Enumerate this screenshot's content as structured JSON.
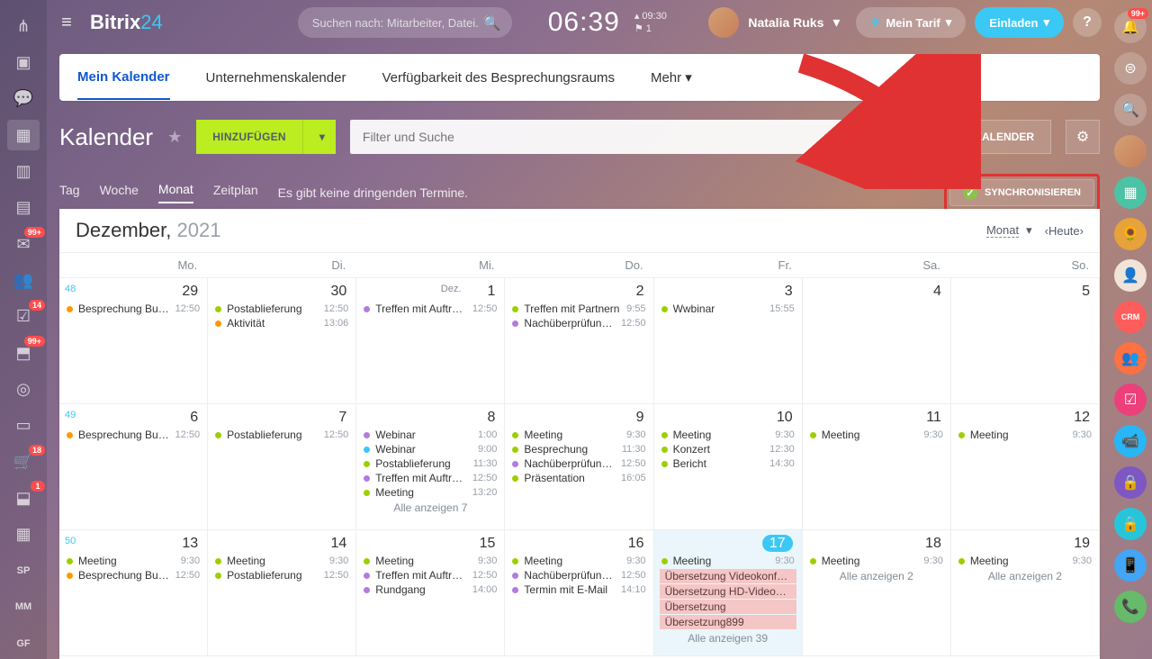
{
  "topbar": {
    "logo_prefix": "Bitrix",
    "logo_suffix": "24",
    "search_placeholder": "Suchen nach: Mitarbeiter, Datei...",
    "clock": "06:39",
    "clock_time": "09:30",
    "clock_flag": "1",
    "username": "Natalia Ruks",
    "tarif": "Mein Tarif",
    "invite": "Einladen"
  },
  "tabs": {
    "items": [
      "Mein Kalender",
      "Unternehmenskalender",
      "Verfügbarkeit des Besprechungsraums",
      "Mehr"
    ]
  },
  "header": {
    "title": "Kalender",
    "add": "HINZUFÜGEN",
    "filter_placeholder": "Filter und Suche",
    "kalender": "KALENDER"
  },
  "viewbar": {
    "tag": "Tag",
    "woche": "Woche",
    "monat": "Monat",
    "zeitplan": "Zeitplan",
    "msg": "Es gibt keine dringenden Termine.",
    "sync": "SYNCHRONISIEREN"
  },
  "calhead": {
    "month": "Dezember, ",
    "year": "2021",
    "monat": "Monat",
    "heute": "Heute"
  },
  "weekdays": [
    "Mo.",
    "Di.",
    "Mi.",
    "Do.",
    "Fr.",
    "Sa.",
    "So."
  ],
  "left_rail": [
    {
      "icon": "⋔"
    },
    {
      "icon": "▣"
    },
    {
      "icon": "💬"
    },
    {
      "icon": "▦",
      "active": true
    },
    {
      "icon": "▥"
    },
    {
      "icon": "▤"
    },
    {
      "icon": "✉",
      "badge": "99+"
    },
    {
      "icon": "👥"
    },
    {
      "icon": "☑",
      "badge": "14"
    },
    {
      "icon": "⬒",
      "badge": "99+"
    },
    {
      "icon": "◎"
    },
    {
      "icon": "▭"
    },
    {
      "icon": "🛒",
      "badge": "18"
    },
    {
      "icon": "⬓",
      "badge": "1"
    },
    {
      "icon": "▦"
    },
    {
      "txt": "SP"
    },
    {
      "txt": "MM"
    },
    {
      "txt": "GF"
    }
  ],
  "right_rail": [
    {
      "bg": "rgba(255,255,255,.2)",
      "icon": "🔔",
      "badge": "99+"
    },
    {
      "bg": "rgba(255,255,255,.2)",
      "icon": "⊜"
    },
    {
      "bg": "rgba(255,255,255,.2)",
      "icon": "🔍"
    },
    {
      "bg": "linear-gradient(135deg,#d4a074,#c67e5a)",
      "icon": ""
    },
    {
      "bg": "#4cc3a5",
      "icon": "▦"
    },
    {
      "bg": "#e8a23a",
      "icon": "🌻"
    },
    {
      "bg": "#f0e4d8",
      "icon": "👤"
    },
    {
      "bg": "#ff5c5c",
      "icon": "CRM",
      "txt": true
    },
    {
      "bg": "#ff7043",
      "icon": "👥"
    },
    {
      "bg": "#ec407a",
      "icon": "☑"
    },
    {
      "bg": "#29b6f6",
      "icon": "📹"
    },
    {
      "bg": "#7e57c2",
      "icon": "🔒"
    },
    {
      "bg": "#26c6da",
      "icon": "🔒"
    },
    {
      "bg": "#42a5f5",
      "icon": "📱"
    },
    {
      "bg": "#66bb6a",
      "icon": "📞"
    }
  ],
  "colors": {
    "green": "#9dcf00",
    "purple": "#b47ade",
    "orange": "#ff9800",
    "cyan": "#3bc8f5"
  },
  "weeks": [
    {
      "wk": "48",
      "days": [
        {
          "n": "29",
          "ev": [
            {
              "c": "orange",
              "t": "Besprechung Buchh...",
              "tm": "12:50"
            }
          ]
        },
        {
          "n": "30",
          "ev": [
            {
              "c": "green",
              "t": "Postablieferung",
              "tm": "12:50"
            },
            {
              "c": "orange",
              "t": "Aktivität",
              "tm": "13:06"
            }
          ]
        },
        {
          "n": "1",
          "sub": "Dez.",
          "ev": [
            {
              "c": "purple",
              "t": "Treffen mit Auftrag...",
              "tm": "12:50"
            }
          ]
        },
        {
          "n": "2",
          "ev": [
            {
              "c": "green",
              "t": "Treffen mit Partnern",
              "tm": "9:55"
            },
            {
              "c": "purple",
              "t": "Nachüberprüfung IT...",
              "tm": "12:50"
            }
          ]
        },
        {
          "n": "3",
          "ev": [
            {
              "c": "green",
              "t": "Wwbinar",
              "tm": "15:55"
            }
          ]
        },
        {
          "n": "4",
          "ev": []
        },
        {
          "n": "5",
          "ev": []
        }
      ]
    },
    {
      "wk": "49",
      "days": [
        {
          "n": "6",
          "ev": [
            {
              "c": "orange",
              "t": "Besprechung Buchh...",
              "tm": "12:50"
            }
          ]
        },
        {
          "n": "7",
          "ev": [
            {
              "c": "green",
              "t": "Postablieferung",
              "tm": "12:50"
            }
          ]
        },
        {
          "n": "8",
          "ev": [
            {
              "c": "purple",
              "t": "Webinar",
              "tm": "1:00"
            },
            {
              "c": "cyan",
              "t": "Webinar",
              "tm": "9:00"
            },
            {
              "c": "green",
              "t": "Postablieferung",
              "tm": "11:30"
            },
            {
              "c": "purple",
              "t": "Treffen mit Auftrag...",
              "tm": "12:50"
            },
            {
              "c": "green",
              "t": "Meeting",
              "tm": "13:20"
            }
          ],
          "more": "Alle anzeigen 7"
        },
        {
          "n": "9",
          "ev": [
            {
              "c": "green",
              "t": "Meeting",
              "tm": "9:30"
            },
            {
              "c": "green",
              "t": "Besprechung",
              "tm": "11:30"
            },
            {
              "c": "purple",
              "t": "Nachüberprüfung IT...",
              "tm": "12:50"
            },
            {
              "c": "green",
              "t": "Präsentation",
              "tm": "16:05"
            }
          ]
        },
        {
          "n": "10",
          "ev": [
            {
              "c": "green",
              "t": "Meeting",
              "tm": "9:30"
            },
            {
              "c": "green",
              "t": "Konzert",
              "tm": "12:30"
            },
            {
              "c": "green",
              "t": "Bericht",
              "tm": "14:30"
            }
          ]
        },
        {
          "n": "11",
          "ev": [
            {
              "c": "green",
              "t": "Meeting",
              "tm": "9:30"
            }
          ]
        },
        {
          "n": "12",
          "ev": [
            {
              "c": "green",
              "t": "Meeting",
              "tm": "9:30"
            }
          ]
        }
      ]
    },
    {
      "wk": "50",
      "days": [
        {
          "n": "13",
          "ev": [
            {
              "c": "green",
              "t": "Meeting",
              "tm": "9:30"
            },
            {
              "c": "orange",
              "t": "Besprechung Buchh...",
              "tm": "12:50"
            }
          ]
        },
        {
          "n": "14",
          "ev": [
            {
              "c": "green",
              "t": "Meeting",
              "tm": "9:30"
            },
            {
              "c": "green",
              "t": "Postablieferung",
              "tm": "12:50"
            }
          ]
        },
        {
          "n": "15",
          "ev": [
            {
              "c": "green",
              "t": "Meeting",
              "tm": "9:30"
            },
            {
              "c": "purple",
              "t": "Treffen mit Auftrag...",
              "tm": "12:50"
            },
            {
              "c": "purple",
              "t": "Rundgang",
              "tm": "14:00"
            }
          ]
        },
        {
          "n": "16",
          "ev": [
            {
              "c": "green",
              "t": "Meeting",
              "tm": "9:30"
            },
            {
              "c": "purple",
              "t": "Nachüberprüfung IT...",
              "tm": "12:50"
            },
            {
              "c": "purple",
              "t": "Termin mit E-Mail",
              "tm": "14:10"
            }
          ]
        },
        {
          "n": "17",
          "today": true,
          "ev": [
            {
              "c": "green",
              "t": "Meeting",
              "tm": "9:30"
            }
          ],
          "bars": [
            "Übersetzung Videokonfere...",
            "Übersetzung HD-Videoanr...",
            "Übersetzung",
            "Übersetzung899"
          ],
          "more": "Alle anzeigen 39"
        },
        {
          "n": "18",
          "ev": [
            {
              "c": "green",
              "t": "Meeting",
              "tm": "9:30"
            }
          ],
          "more": "Alle anzeigen 2"
        },
        {
          "n": "19",
          "ev": [
            {
              "c": "green",
              "t": "Meeting",
              "tm": "9:30"
            }
          ],
          "more": "Alle anzeigen 2"
        }
      ]
    }
  ]
}
